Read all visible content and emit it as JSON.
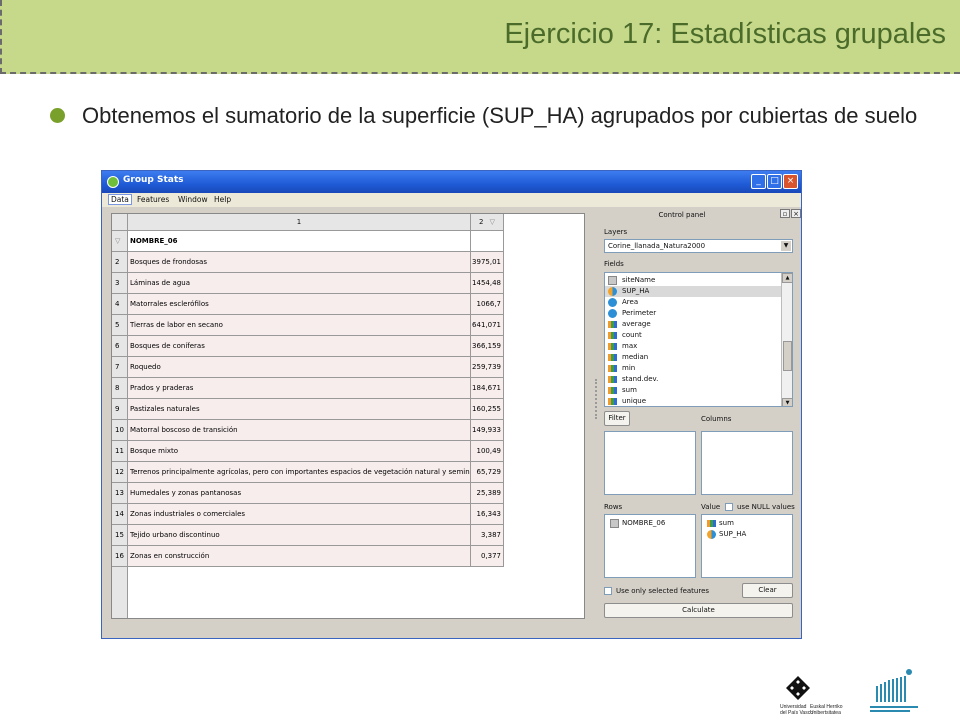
{
  "slide": {
    "title": "Ejercicio 17: Estadísticas grupales",
    "bullet": "Obtenemos el sumatorio de la superficie (SUP_HA) agrupados por cubiertas de suelo"
  },
  "window": {
    "title": "Group Stats",
    "buttons": {
      "minimize": "_",
      "maximize": "□",
      "close": "×"
    },
    "menu": [
      "Data",
      "Features",
      "Window",
      "Help"
    ],
    "active_menu": "Data"
  },
  "table": {
    "column_headers": [
      "1",
      "2"
    ],
    "header_row": {
      "row": "1",
      "label": "NOMBRE_06",
      "value": ""
    },
    "rows": [
      {
        "row": "2",
        "label": "Bosques de frondosas",
        "value": "3975,01"
      },
      {
        "row": "3",
        "label": "Láminas de agua",
        "value": "1454,48"
      },
      {
        "row": "4",
        "label": "Matorrales esclerófilos",
        "value": "1066,7"
      },
      {
        "row": "5",
        "label": "Tierras de labor en secano",
        "value": "641,071"
      },
      {
        "row": "6",
        "label": "Bosques de coníferas",
        "value": "366,159"
      },
      {
        "row": "7",
        "label": "Roquedo",
        "value": "259,739"
      },
      {
        "row": "8",
        "label": "Prados y praderas",
        "value": "184,671"
      },
      {
        "row": "9",
        "label": "Pastizales naturales",
        "value": "160,255"
      },
      {
        "row": "10",
        "label": "Matorral boscoso de transición",
        "value": "149,933"
      },
      {
        "row": "11",
        "label": "Bosque mixto",
        "value": "100,49"
      },
      {
        "row": "12",
        "label": "Terrenos principalmente agrícolas, pero con importantes espacios de vegetación natural y seminatural",
        "value": "65,729"
      },
      {
        "row": "13",
        "label": "Humedales y zonas pantanosas",
        "value": "25,389"
      },
      {
        "row": "14",
        "label": "Zonas industriales o comerciales",
        "value": "16,343"
      },
      {
        "row": "15",
        "label": "Tejido urbano discontinuo",
        "value": "3,387"
      },
      {
        "row": "16",
        "label": "Zonas en construcción",
        "value": "0,377"
      }
    ]
  },
  "control_panel": {
    "title": "Control panel",
    "layers_label": "Layers",
    "layer_selected": "Corine_llanada_Natura2000",
    "fields_label": "Fields",
    "fields": [
      {
        "name": "siteName",
        "icon": "text-field-icon"
      },
      {
        "name": "SUP_HA",
        "icon": "numeric-field-icon",
        "selected": true
      },
      {
        "name": "Area",
        "icon": "numeric-field-icon"
      },
      {
        "name": "Perimeter",
        "icon": "numeric-field-icon"
      },
      {
        "name": "average",
        "icon": "statistic-icon"
      },
      {
        "name": "count",
        "icon": "statistic-icon"
      },
      {
        "name": "max",
        "icon": "statistic-icon"
      },
      {
        "name": "median",
        "icon": "statistic-icon"
      },
      {
        "name": "min",
        "icon": "statistic-icon"
      },
      {
        "name": "stand.dev.",
        "icon": "statistic-icon"
      },
      {
        "name": "sum",
        "icon": "statistic-icon"
      },
      {
        "name": "unique",
        "icon": "statistic-icon"
      }
    ],
    "filter_button": "Filter",
    "columns_label": "Columns",
    "rows_label": "Rows",
    "rows_items": [
      "NOMBRE_06"
    ],
    "value_label": "Value",
    "use_null_label": "use NULL values",
    "value_items": [
      "sum",
      "SUP_HA"
    ],
    "use_selected_label": "Use only selected features",
    "clear_button": "Clear",
    "calculate_button": "Calculate"
  },
  "logos": {
    "upv_line1": "Universidad",
    "upv_line2": "del País Vasco",
    "upv_line3": "Euskal Herriko",
    "upv_line4": "Unibertsitatea"
  },
  "colors": {
    "header_band": "#c6d98a",
    "title_text": "#4b6b2a",
    "bullet": "#7aa02c",
    "titlebar": "#1f5bd6",
    "cell_bg": "#f7eded"
  }
}
